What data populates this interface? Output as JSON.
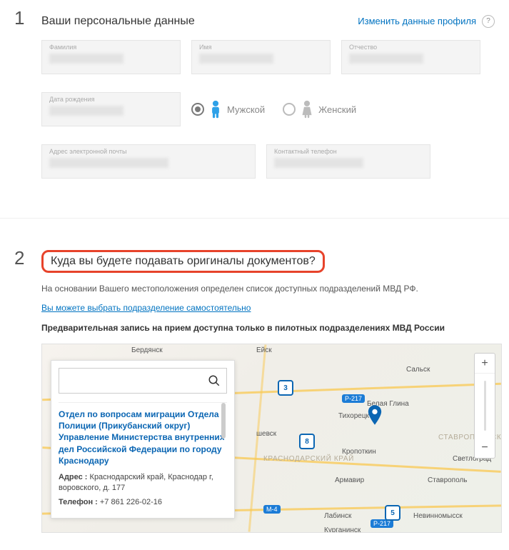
{
  "section1": {
    "number": "1",
    "title": "Ваши персональные данные",
    "edit_link": "Изменить данные профиля",
    "help": "?",
    "fields": {
      "surname_label": "Фамилия",
      "name_label": "Имя",
      "patronymic_label": "Отчество",
      "dob_label": "Дата рождения",
      "email_label": "Адрес электронной почты",
      "phone_label": "Контактный телефон"
    },
    "gender": {
      "male": "Мужской",
      "female": "Женский",
      "selected": "male"
    }
  },
  "section2": {
    "number": "2",
    "title": "Куда вы будете подавать оригиналы документов?",
    "info": "На основании Вашего местоположения определен список доступных подразделений МВД РФ.",
    "choose_link": "Вы можете выбрать подразделение самостоятельно",
    "note": "Предварительная запись на прием доступна только в пилотных подразделениях МВД России"
  },
  "map": {
    "search_placeholder": "",
    "zoom_in": "+",
    "zoom_out": "−",
    "regions": {
      "krasnodar": "КРАСНОДАРСКИЙ КРАЙ",
      "stavropol": "СТАВРОПОЛЬСКИЙ"
    },
    "cities": {
      "berdyansk": "Бердянск",
      "yeysk": "Ейск",
      "salsk": "Сальск",
      "tikhoretsk": "Тихорецк",
      "belaya_glina": "Белая Глина",
      "kropotkin": "Кропоткин",
      "shevsk": "шевск",
      "armavir": "Армавир",
      "stavropol_city": "Ставрополь",
      "svetlograd": "Светлоград",
      "labinsk": "Лабинск",
      "nevinnomyssk": "Невинномысск",
      "kurganinsk": "Курганинск"
    },
    "roads": {
      "m4": "М-4",
      "r217a": "Р-217",
      "r217b": "Р-217"
    },
    "markers": {
      "m3": "3",
      "m8": "8",
      "m5": "5"
    },
    "result": {
      "title": "Отдел по вопросам миграции Отдела Полиции (Прикубанский округ) Управление Министерства внутренних дел Российской Федерации по городу Краснодару",
      "address_label": "Адрес :",
      "address": "Краснодарский край, Краснодар г, воровского, д. 177",
      "phone_label": "Телефон :",
      "phone": "+7 861 226-02-16"
    }
  }
}
